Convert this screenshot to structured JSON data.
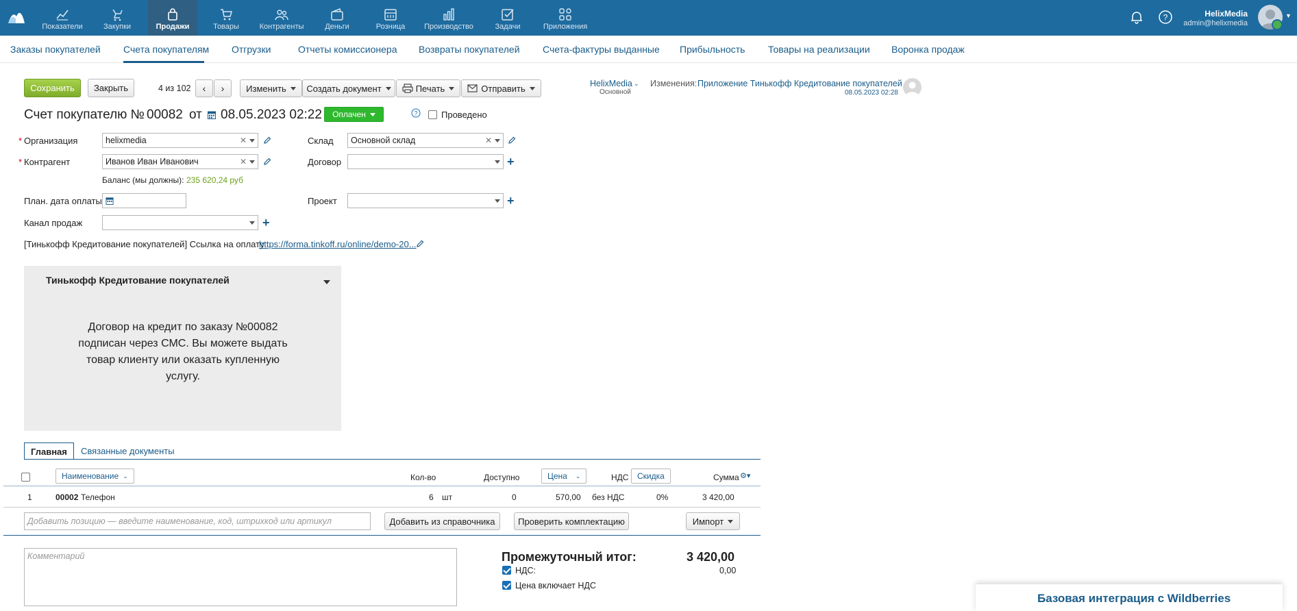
{
  "topnav": {
    "items": [
      {
        "label": "Показатели",
        "icon": "chart-icon"
      },
      {
        "label": "Закупки",
        "icon": "purchase-icon"
      },
      {
        "label": "Продажи",
        "icon": "bag-icon"
      },
      {
        "label": "Товары",
        "icon": "cart-icon"
      },
      {
        "label": "Контрагенты",
        "icon": "people-icon"
      },
      {
        "label": "Деньги",
        "icon": "wallet-icon"
      },
      {
        "label": "Розница",
        "icon": "register-icon"
      },
      {
        "label": "Производство",
        "icon": "factory-icon"
      },
      {
        "label": "Задачи",
        "icon": "task-icon"
      },
      {
        "label": "Приложения",
        "icon": "apps-icon"
      }
    ],
    "active": "Продажи",
    "user_name": "HelixMedia",
    "user_email": "admin@helixmedia"
  },
  "subnav": {
    "items": [
      "Заказы покупателей",
      "Счета покупателям",
      "Отгрузки",
      "Отчеты комиссионера",
      "Возвраты покупателей",
      "Счета-фактуры выданные",
      "Прибыльность",
      "Товары на реализации",
      "Воронка продаж"
    ],
    "active": "Счета покупателям"
  },
  "toolbar": {
    "save": "Сохранить",
    "close": "Закрыть",
    "pager": "4 из 102",
    "edit": "Изменить",
    "create_doc": "Создать документ",
    "print": "Печать",
    "send": "Отправить"
  },
  "meta": {
    "owner": "HelixMedia",
    "owner_sub": "Основной",
    "changes_label": "Изменения:",
    "changes_by": "Приложение Тинькофф Кредитование покупателей",
    "changes_date": "08.05.2023 02:28"
  },
  "doc": {
    "title_prefix": "Счет покупателю №",
    "number": "00082",
    "from": "от",
    "date": "08.05.2023 02:22",
    "status": "Оплачен",
    "status_color": "#2eb82e",
    "posted_label": "Проведено",
    "help": "?"
  },
  "form": {
    "org_label": "Организация",
    "org_value": "helixmedia",
    "contractor_label": "Контрагент",
    "contractor_value": "Иванов Иван Иванович",
    "balance_label": "Баланс (мы должны):",
    "balance_value": "235 620,24 руб",
    "plan_date_label": "План. дата оплаты",
    "channel_label": "Канал продаж",
    "warehouse_label": "Склад",
    "warehouse_value": "Основной склад",
    "contract_label": "Договор",
    "project_label": "Проект",
    "tinkoff_link_label": "[Тинькофф Кредитование покупателей] Ссылка на оплату",
    "tinkoff_link_value": "https://forma.tinkoff.ru/online/demo-20..."
  },
  "panel": {
    "title": "Тинькофф Кредитование покупателей",
    "body": "Договор на кредит по заказу №00082 подписан через СМС. Вы можете выдать товар клиенту или оказать купленную услугу."
  },
  "tabs": [
    "Главная",
    "Связанные документы"
  ],
  "table": {
    "headers": {
      "name": "Наименование",
      "qty": "Кол-во",
      "available": "Доступно",
      "price": "Цена",
      "vat": "НДС",
      "discount": "Скидка",
      "sum": "Сумма"
    },
    "rows": [
      {
        "n": "1",
        "code": "00002",
        "name": "Телефон",
        "qty": "6",
        "unit": "шт",
        "available": "0",
        "price": "570,00",
        "vat": "без НДС",
        "discount": "0%",
        "sum": "3 420,00"
      }
    ]
  },
  "add": {
    "placeholder": "Добавить позицию — введите наименование, код, штрихкод или артикул",
    "from_catalog": "Добавить из справочника",
    "check_set": "Проверить комплектацию",
    "import": "Импорт"
  },
  "totals": {
    "comment_placeholder": "Комментарий",
    "subtotal_label": "Промежуточный итог:",
    "subtotal_value": "3 420,00",
    "vat_label": "НДС:",
    "vat_value": "0,00",
    "price_incl_vat": "Цена включает НДС"
  },
  "toast": "Базовая интеграция с Wildberries"
}
